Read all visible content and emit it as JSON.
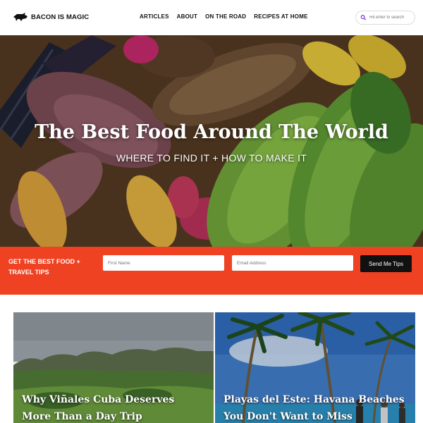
{
  "header": {
    "logo_text": "BACON IS MAGIC",
    "nav": [
      "ARTICLES",
      "ABOUT",
      "ON THE ROAD",
      "RECIPES AT HOME"
    ],
    "search_placeholder": "Hit enter to search"
  },
  "hero": {
    "title": "The Best Food Around The World",
    "subtitle": "WHERE TO FIND IT + HOW TO MAKE IT"
  },
  "signup": {
    "label": "GET THE BEST FOOD + TRAVEL TIPS",
    "first_name_placeholder": "First Name",
    "email_placeholder": "Email Address",
    "button_label": "Send Me Tips"
  },
  "articles": [
    {
      "title": "Why Viñales Cuba Deserves More Than a Day Trip"
    },
    {
      "title": "Playas del Este: Havana Beaches You Don't Want to Miss"
    }
  ],
  "colors": {
    "accent": "#ef4223",
    "button": "#111111"
  },
  "icons": [
    "pig-logo-icon",
    "search-icon"
  ]
}
